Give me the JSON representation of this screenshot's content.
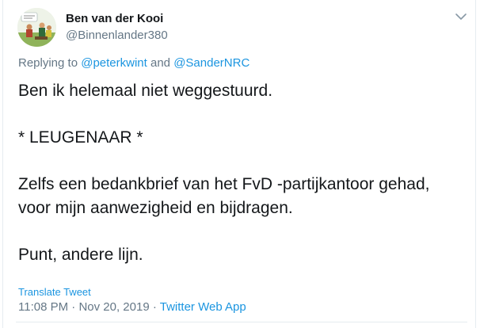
{
  "tweet": {
    "author_name": "Ben van der Kooi",
    "author_handle": "@Binnenlander380",
    "replying_prefix": "Replying to",
    "reply_to_1": "@peterkwint",
    "reply_and": "and",
    "reply_to_2": "@SanderNRC",
    "lines": [
      "Ben ik helemaal niet weggestuurd.",
      "* LEUGENAAR *",
      "Zelfs een bedankbrief van het FvD -partijkantoor gehad,",
      "voor mijn aanwezigheid en bijdragen.",
      "Punt, andere lijn."
    ],
    "translate_label": "Translate Tweet",
    "time": "11:08 PM",
    "date": "Nov 20, 2019",
    "separator": "·",
    "source_app": "Twitter Web App"
  },
  "icons": {
    "menu": "chevron-down-icon"
  },
  "colors": {
    "link": "#1b95e0",
    "secondary_text": "#657786",
    "primary_text": "#14171a",
    "border": "#e6ecf0"
  }
}
